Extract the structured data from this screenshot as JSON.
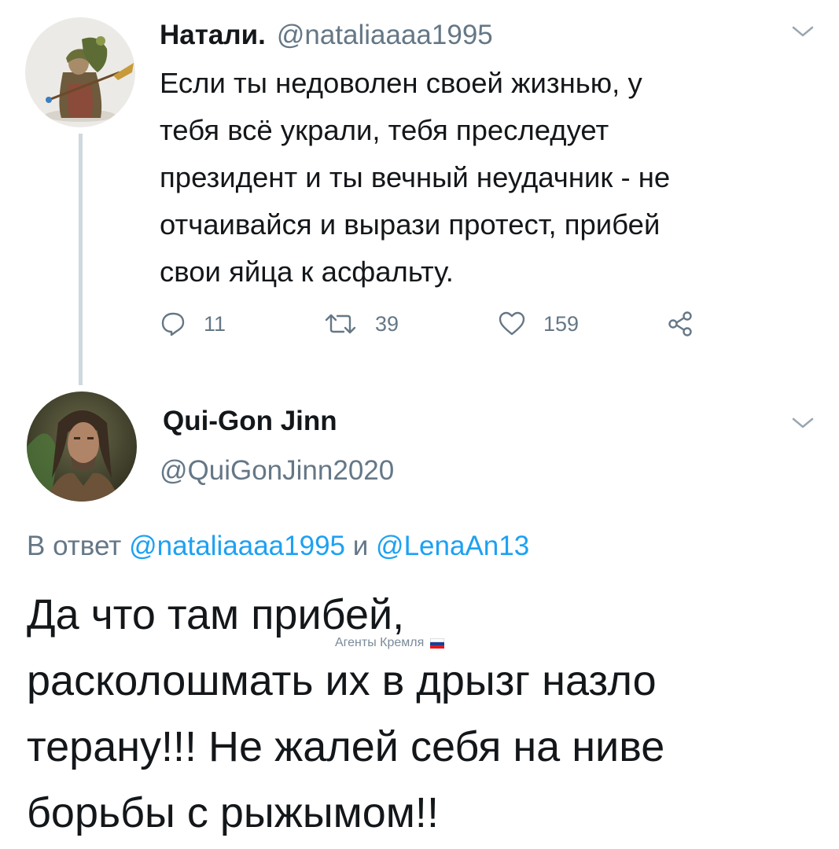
{
  "tweet1": {
    "author_name": "Натали.",
    "author_handle": "@nataliaaaa1995",
    "body_lines": [
      "Если ты недоволен своей жизнью, у",
      "тебя всё украли, тебя преследует",
      "президент и ты вечный неудачник - не",
      "отчаивайся и вырази протест, прибей",
      "свои яйца к асфальту."
    ],
    "replies": "11",
    "retweets": "39",
    "likes": "159"
  },
  "tweet2": {
    "author_name": "Qui-Gon Jinn",
    "author_handle": "@QuiGonJinn2020",
    "reply_prefix": "В ответ",
    "reply_user1": "@nataliaaaa1995",
    "reply_conj": "и",
    "reply_user2": "@LenaAn13",
    "body_lines": [
      "Да что там прибей,",
      "расколошмать их в дрызг назло",
      "терану!!! Не жалей себя на ниве",
      "борьбы с рыжымом!!"
    ]
  },
  "watermark": {
    "text": "Агенты Кремля",
    "flag_colors": [
      "#ffffff",
      "#1c3f94",
      "#e4181c"
    ]
  },
  "icons": {
    "reply": "reply-icon",
    "retweet": "retweet-icon",
    "like": "heart-icon",
    "share": "share-icon",
    "menu": "chevron-down-icon"
  },
  "colors": {
    "text": "#14171a",
    "secondary": "#657786",
    "link": "#1da1f2",
    "thread_line": "#cfd9de"
  }
}
